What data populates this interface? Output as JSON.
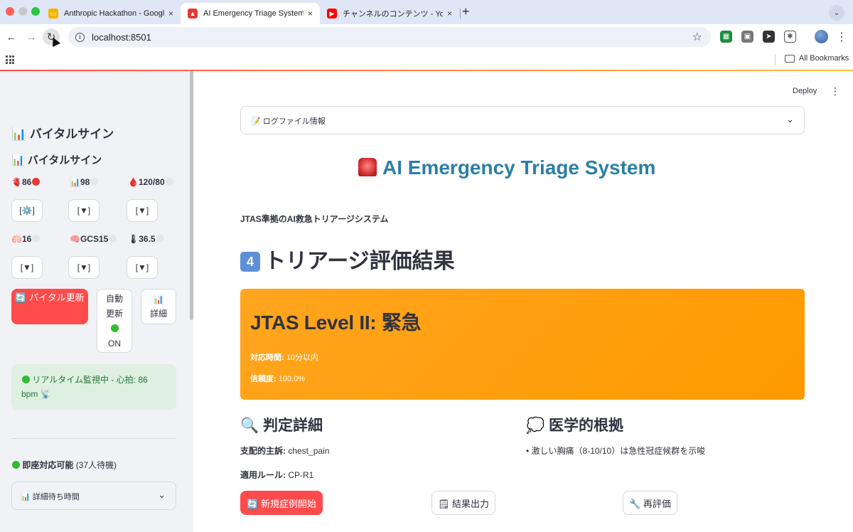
{
  "browser": {
    "tabs": [
      {
        "title": "Anthropic Hackathon - Googl",
        "active": false
      },
      {
        "title": "AI Emergency Triage System",
        "active": true
      },
      {
        "title": "チャンネルのコンテンツ - YouTu",
        "active": false
      }
    ],
    "url": "localhost:8501",
    "bookmarks_label": "All Bookmarks",
    "new_tab_symbol": "+",
    "close_symbol": "×"
  },
  "sidebar": {
    "heading1": "📊 バイタルサイン",
    "heading2": "📊 バイタルサイン",
    "vitals_row1": [
      {
        "icon": "heart-icon",
        "text": "🫀86"
      },
      {
        "icon": "chart-icon",
        "text": "📊98"
      },
      {
        "icon": "blood-drop-icon",
        "text": "🩸120/80"
      }
    ],
    "vitals_row2": [
      {
        "icon": "lungs-icon",
        "text": "🫁16"
      },
      {
        "icon": "brain-icon",
        "text": "🧠GCS15"
      },
      {
        "icon": "thermometer-icon",
        "text": "🌡36.5"
      }
    ],
    "buttons_row1": [
      "[⚙️]",
      "[▼]",
      "[▼]"
    ],
    "buttons_row2": [
      "[▼]",
      "[▼]",
      "[▼]"
    ],
    "vital_update_label": "🔄 バイタル更新",
    "auto_update": {
      "line1": "自動",
      "line2": "更新",
      "state": "ON"
    },
    "detail_label_icon": "📊",
    "detail_label": "詳細",
    "monitor_text": "リアルタイム監視中 - 心拍: 86 bpm 📡",
    "immediate_label": "即座対応可能",
    "immediate_count": "(37人待機)",
    "wait_time_label": "📊 詳細待ち時間"
  },
  "main": {
    "deploy_label": "Deploy",
    "menu_symbol": "⋮",
    "log_expander": "📝 ログファイル情報",
    "title": "AI Emergency Triage System",
    "subtitle": "JTAS準拠のAI救急トリアージシステム",
    "section_number": "4",
    "section_title": "トリアージ評価結果",
    "result": {
      "level": "JTAS Level II: 緊急",
      "response_label": "対応時間:",
      "response_value": " 10分以内",
      "confidence_label": "信頼度:",
      "confidence_value": " 100.0%"
    },
    "details_heading": "🔍 判定詳細",
    "evidence_heading": "💭 医学的根拠",
    "chief_complaint_label": "支配的主訴:",
    "chief_complaint_value": " chest_pain",
    "rule_label": "適用ルール:",
    "rule_value": " CP-R1",
    "evidence_item": "• 激しい胸痛（8-10/10）は急性冠症候群を示唆",
    "buttons": {
      "new_case": "🔄 新規症例開始",
      "export": "🗒 結果出力",
      "reevaluate": "🔧 再評価"
    }
  },
  "colors": {
    "accent_red": "#ff4b4b",
    "result_orange": "#ff9a00",
    "title_blue": "#2c7fa6",
    "monitor_green_bg": "#dff0e0"
  }
}
